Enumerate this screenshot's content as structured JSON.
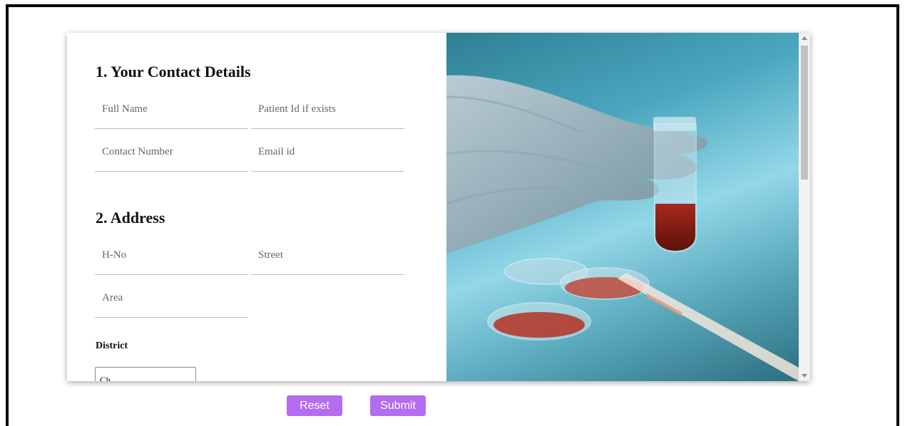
{
  "contact": {
    "title": "1. Your Contact Details",
    "fields": {
      "full_name": {
        "placeholder": "Full Name"
      },
      "patient_id": {
        "placeholder": "Patient Id if exists"
      },
      "contact_number": {
        "placeholder": "Contact Number"
      },
      "email": {
        "placeholder": "Email id"
      }
    }
  },
  "address": {
    "title": "2. Address",
    "fields": {
      "house_no": {
        "placeholder": "H-No"
      },
      "street": {
        "placeholder": "Street"
      },
      "area": {
        "placeholder": "Area"
      }
    },
    "district": {
      "label": "District",
      "selected": "Ch"
    }
  },
  "image": {
    "alt": "Gloved hand holding a test tube with red liquid over petri dishes"
  },
  "buttons": {
    "reset": "Reset",
    "submit": "Submit"
  },
  "colors": {
    "button": "#b46cf0"
  }
}
